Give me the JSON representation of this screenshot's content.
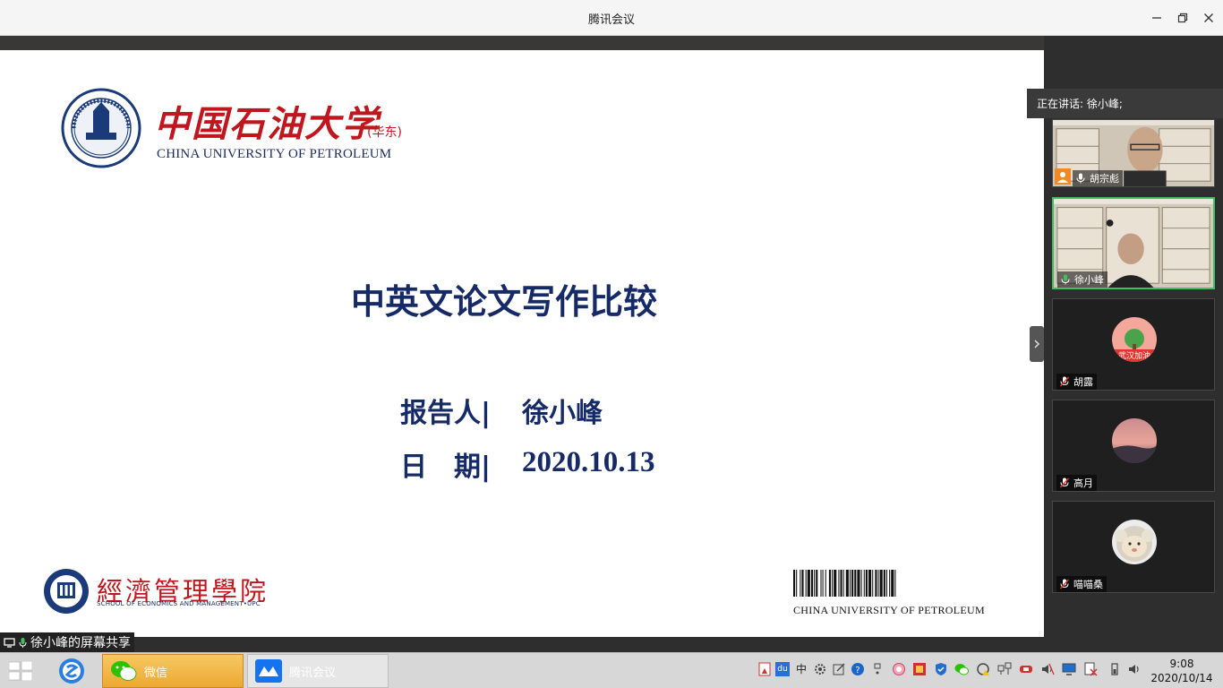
{
  "window": {
    "title": "腾讯会议"
  },
  "slide": {
    "university_cn": "中国石油大学",
    "university_cn_suffix": "(华东)",
    "university_en": "CHINA UNIVERSITY OF PETROLEUM",
    "title": "中英文论文写作比较",
    "reporter_label": "报告人|",
    "reporter_value": "徐小峰",
    "date_label": "日　期|",
    "date_value": "2020.10.13",
    "school_cn": "經濟管理學院",
    "school_en": "SCHOOL OF ECONOMICS AND MANAGEMENT•UPC",
    "footer_en": "CHINA UNIVERSITY OF PETROLEUM"
  },
  "share": {
    "label": "徐小峰的屏幕共享"
  },
  "panel": {
    "speaking": "正在讲话: 徐小峰;",
    "participants": [
      {
        "name": "胡宗彪"
      },
      {
        "name": "徐小峰"
      },
      {
        "name": "胡露"
      },
      {
        "name": "高月"
      },
      {
        "name": "喵喵桑"
      }
    ]
  },
  "taskbar": {
    "apps": [
      {
        "label": "微信"
      },
      {
        "label": "腾讯会议"
      }
    ],
    "tray_ime": "中",
    "tray_du": "du",
    "clock_time": "9:08",
    "clock_date": "2020/10/14"
  },
  "colors": {
    "slide_blue": "#152a66",
    "slide_red": "#c0161d",
    "active_border": "#3fbf5f",
    "wechat_task": "#f1b740"
  }
}
